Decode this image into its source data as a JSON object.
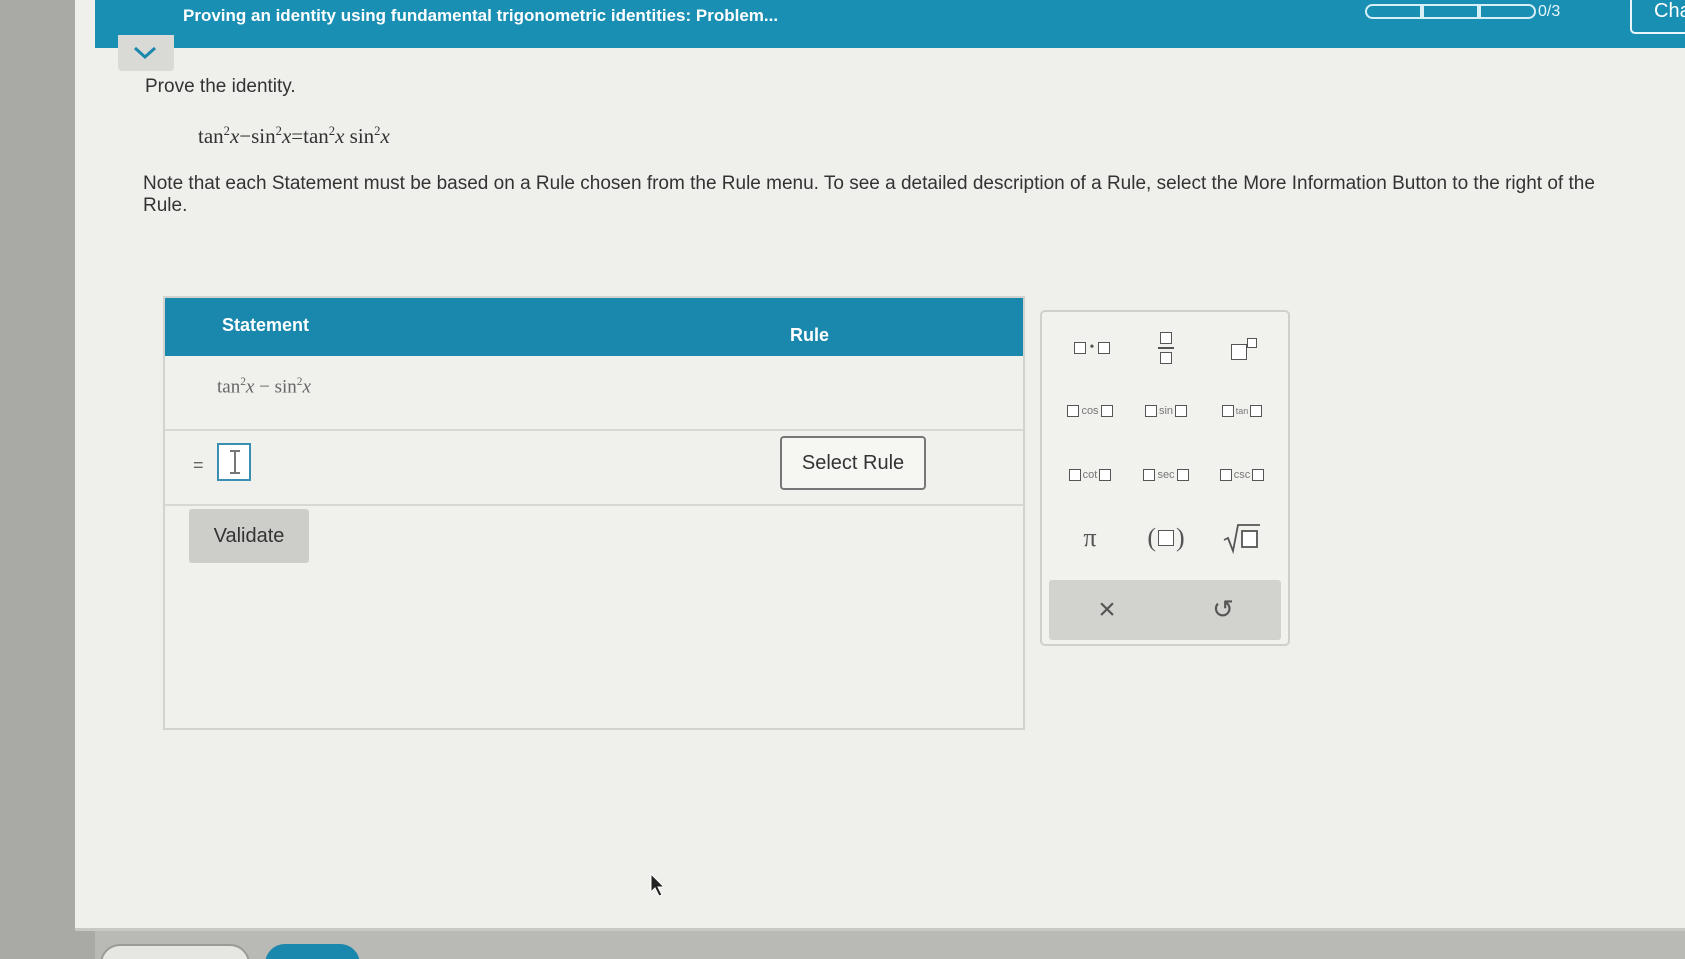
{
  "header": {
    "title": "Proving an identity using fundamental trigonometric identities: Problem...",
    "progress_count": "0/3",
    "progress_filled": 0,
    "progress_total": 3,
    "chat_label": "Cha"
  },
  "problem": {
    "prompt": "Prove the identity.",
    "identity": {
      "lhs1": "tan",
      "exp1": "2",
      "var1": "x",
      "minus": "−",
      "lhs2": "sin",
      "exp2": "2",
      "var2": "x",
      "equals": "=",
      "rhs1": "tan",
      "exp3": "2",
      "var3": "x",
      "rhs2": "sin",
      "exp4": "2",
      "var4": "x"
    },
    "note": "Note that each Statement must be based on a Rule chosen from the Rule menu. To see a detailed description of a Rule, select the More Information Button to the right of the Rule."
  },
  "proof_table": {
    "statement_header": "Statement",
    "rule_header": "Rule",
    "first_statement": {
      "f1": "tan",
      "e1": "2",
      "v1": "x",
      "op": " − ",
      "f2": "sin",
      "e2": "2",
      "v2": "x"
    },
    "equals_sign": "=",
    "select_rule_label": "Select Rule",
    "validate_label": "Validate"
  },
  "keypad": {
    "cos_label": "cos",
    "sin_label": "sin",
    "tan_label": "tan",
    "cot_label": "cot",
    "sec_label": "sec",
    "csc_label": "csc",
    "pi_label": "π",
    "clear_label": "×",
    "undo_label": "↺"
  },
  "colors": {
    "accent": "#1a87ad",
    "header_bar": "#1a8fb4"
  }
}
